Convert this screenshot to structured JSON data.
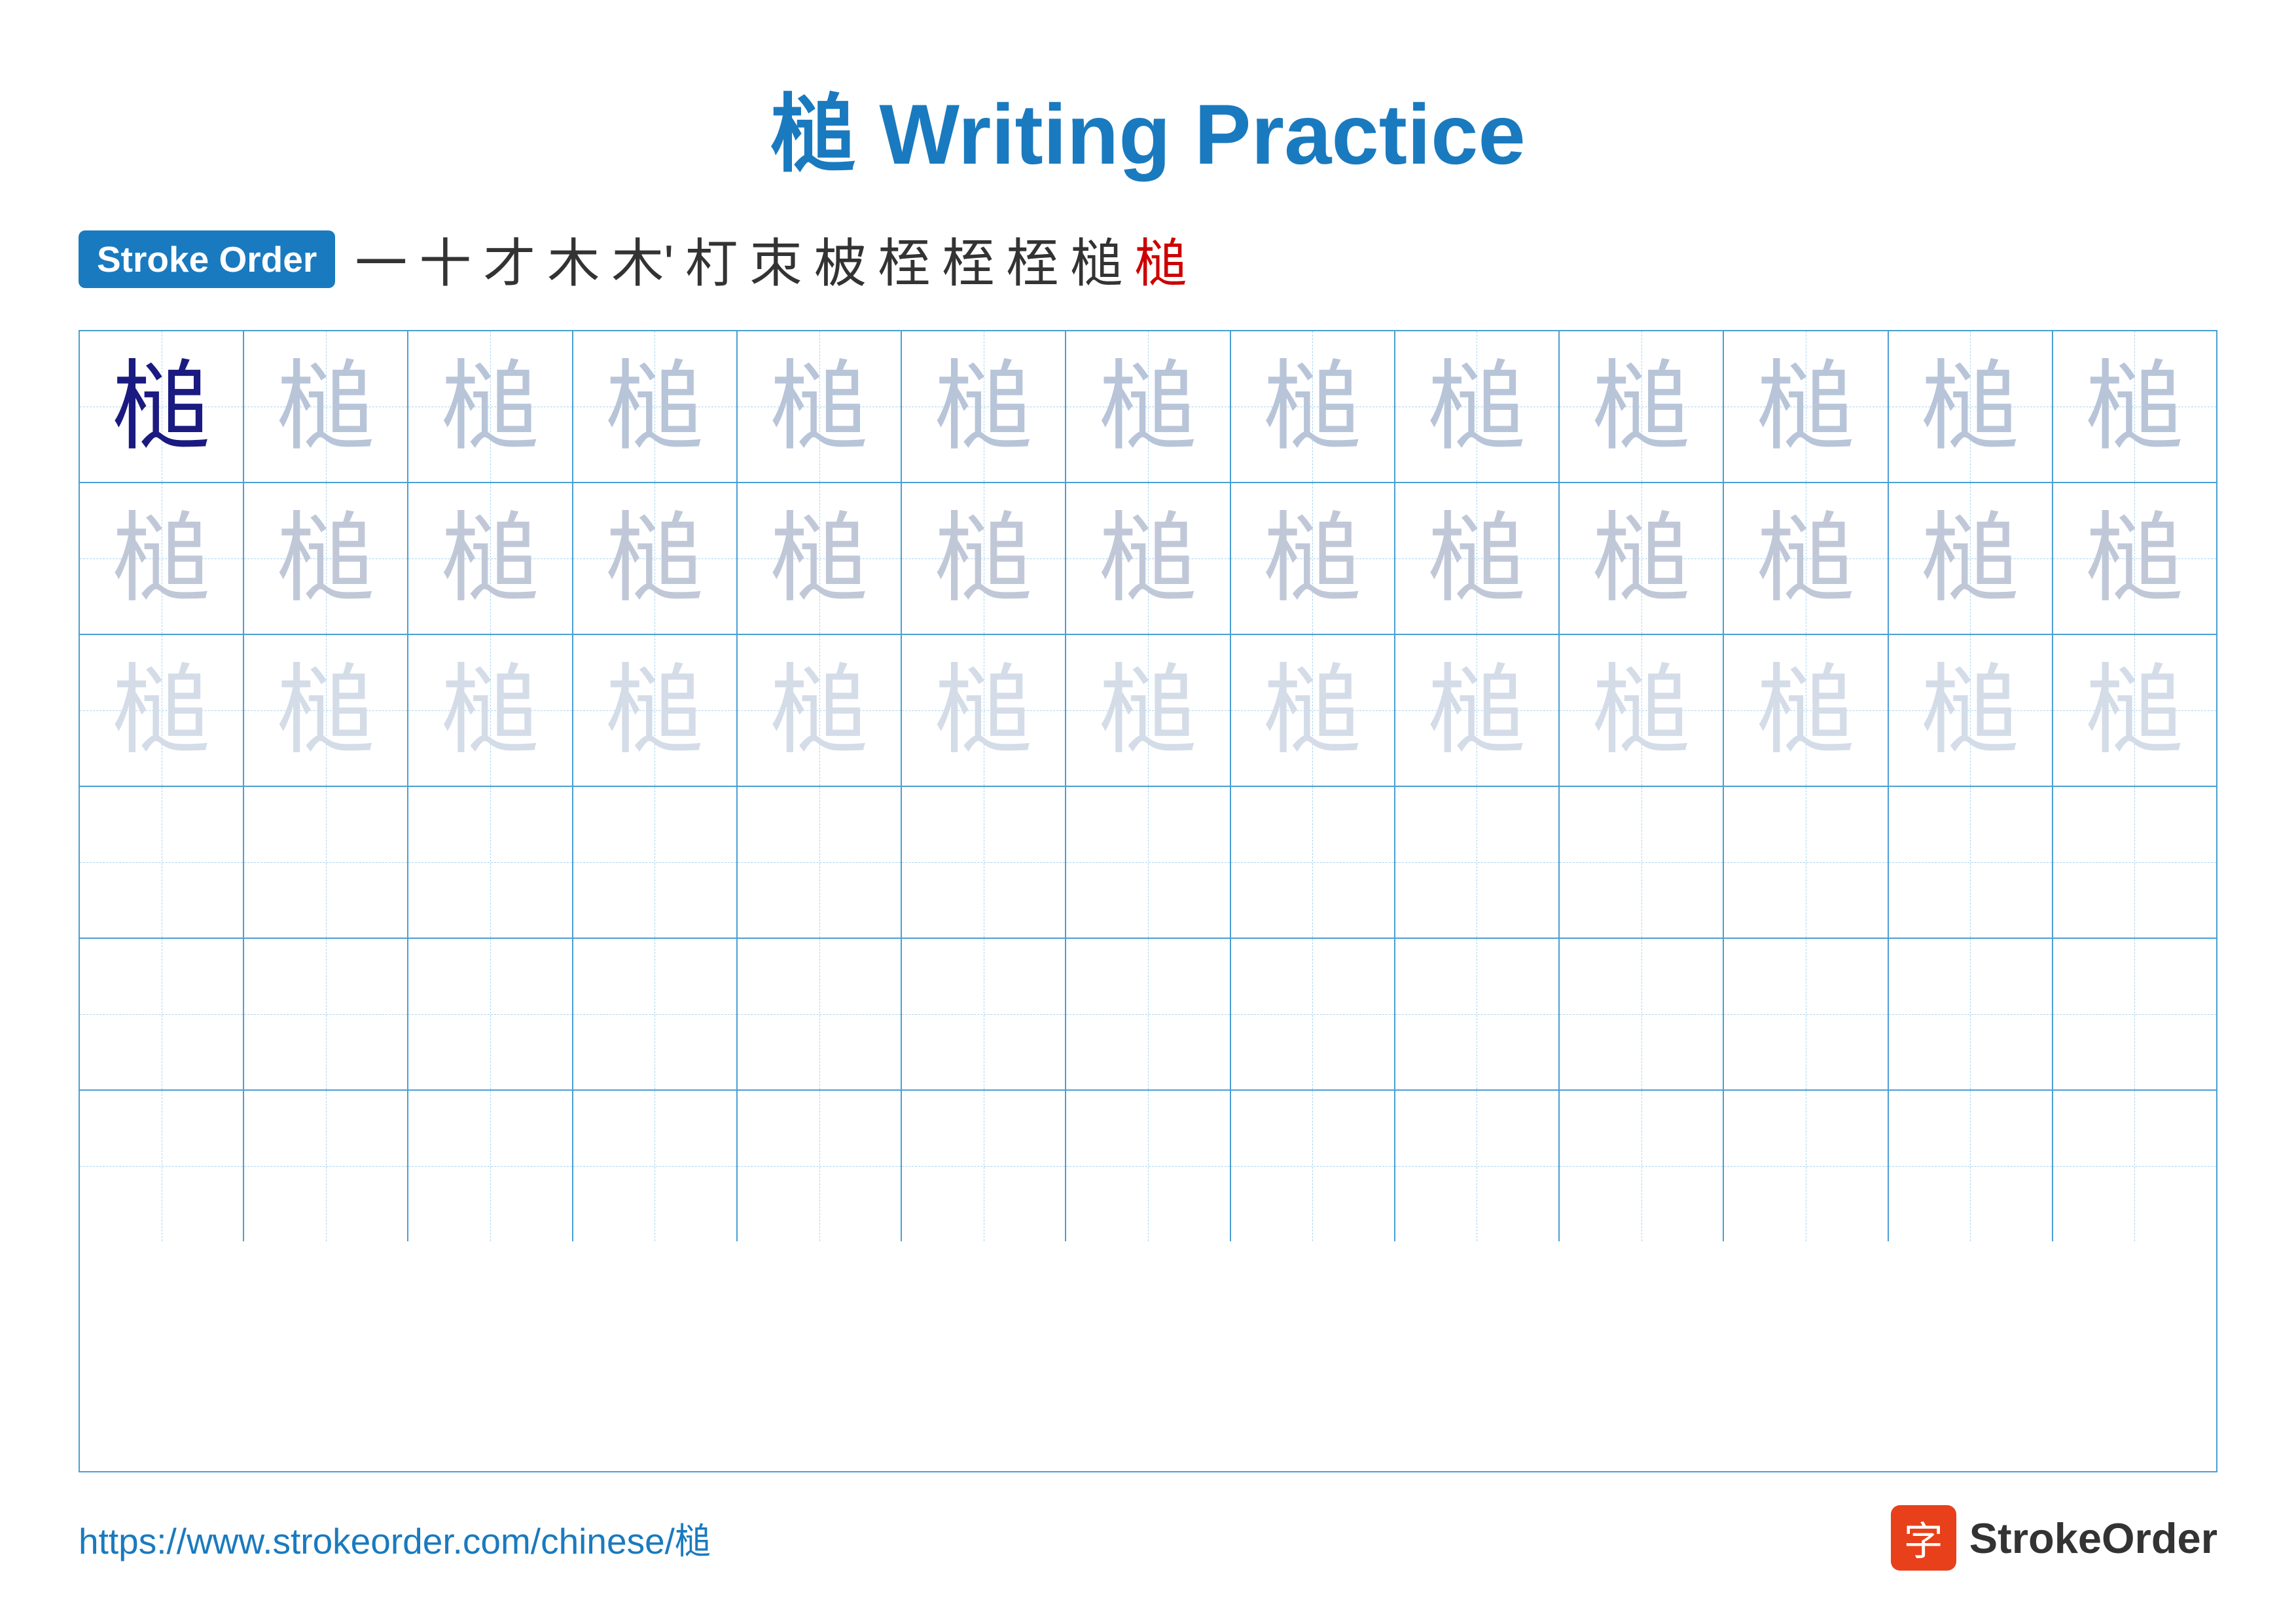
{
  "title": "槌 Writing Practice",
  "stroke_order": {
    "badge_label": "Stroke Order",
    "strokes": [
      "一",
      "十",
      "才",
      "木",
      "木'",
      "朾",
      "朿",
      "柀",
      "桎",
      "桎",
      "桎",
      "槌",
      "槌"
    ]
  },
  "character": "槌",
  "rows": [
    {
      "type": "dark_first",
      "chars": [
        "槌",
        "槌",
        "槌",
        "槌",
        "槌",
        "槌",
        "槌",
        "槌",
        "槌",
        "槌",
        "槌",
        "槌",
        "槌"
      ]
    },
    {
      "type": "medium",
      "chars": [
        "槌",
        "槌",
        "槌",
        "槌",
        "槌",
        "槌",
        "槌",
        "槌",
        "槌",
        "槌",
        "槌",
        "槌",
        "槌"
      ]
    },
    {
      "type": "light",
      "chars": [
        "槌",
        "槌",
        "槌",
        "槌",
        "槌",
        "槌",
        "槌",
        "槌",
        "槌",
        "槌",
        "槌",
        "槌",
        "槌"
      ]
    },
    {
      "type": "empty",
      "chars": [
        "",
        "",
        "",
        "",
        "",
        "",
        "",
        "",
        "",
        "",
        "",
        "",
        ""
      ]
    },
    {
      "type": "empty",
      "chars": [
        "",
        "",
        "",
        "",
        "",
        "",
        "",
        "",
        "",
        "",
        "",
        "",
        ""
      ]
    },
    {
      "type": "empty",
      "chars": [
        "",
        "",
        "",
        "",
        "",
        "",
        "",
        "",
        "",
        "",
        "",
        "",
        ""
      ]
    }
  ],
  "footer": {
    "url": "https://www.strokeorder.com/chinese/槌",
    "logo_text": "StrokeOrder",
    "logo_char": "字"
  }
}
